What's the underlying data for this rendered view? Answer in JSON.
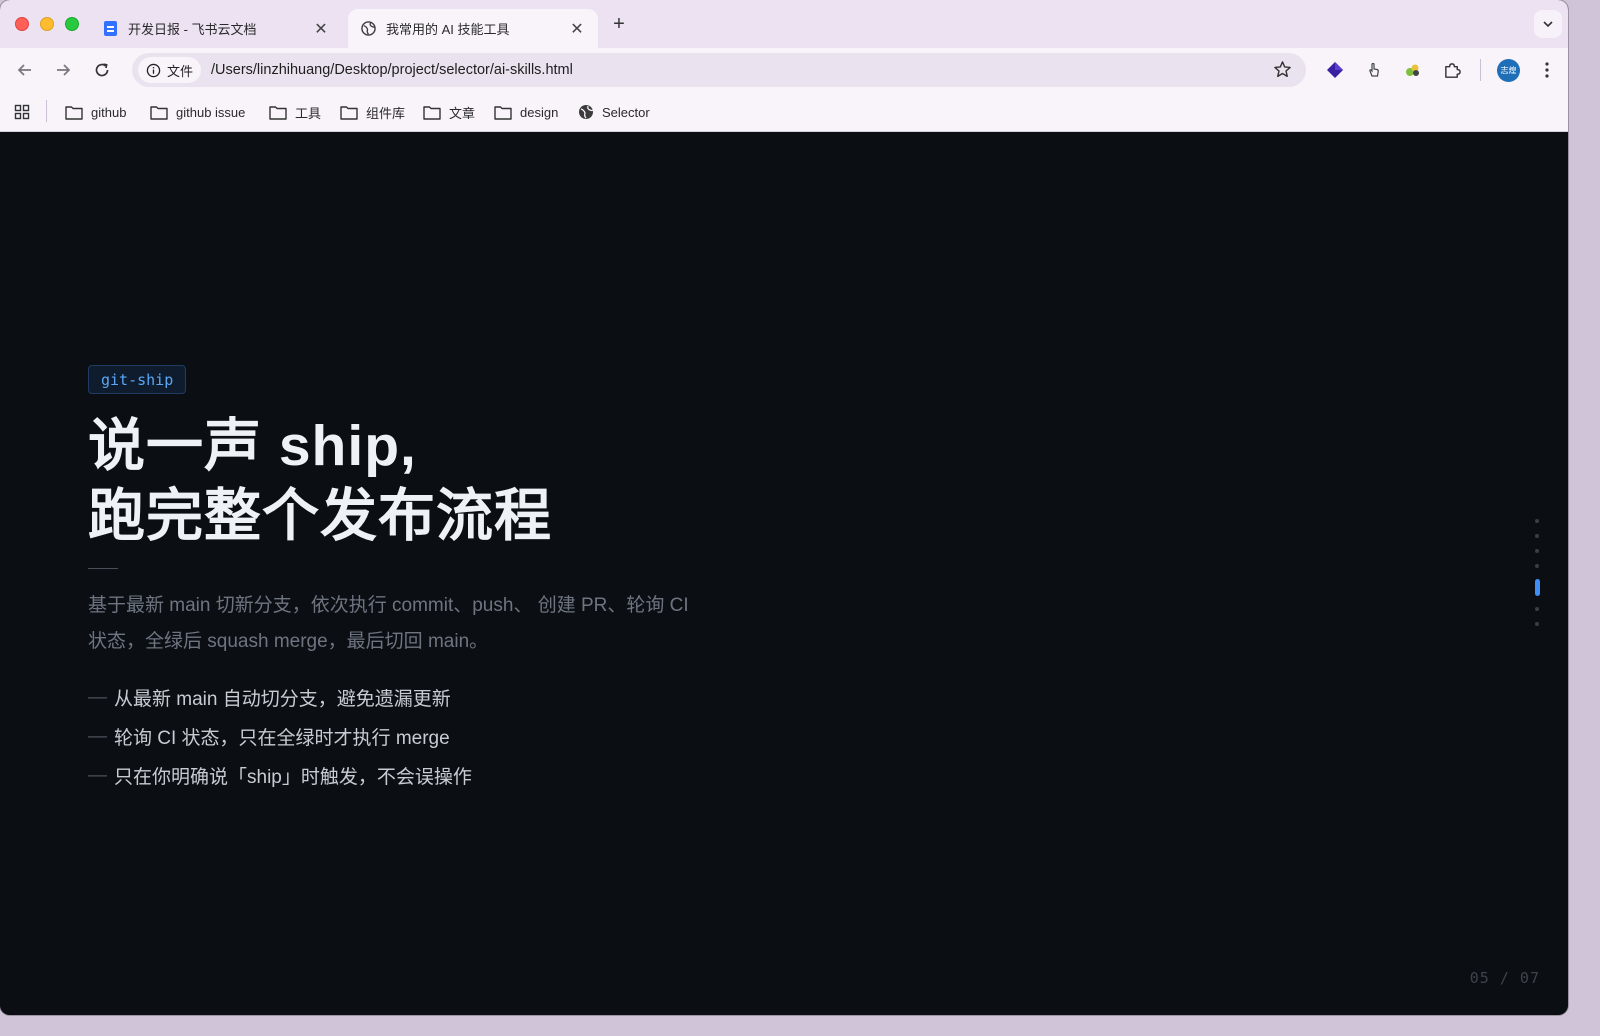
{
  "browser": {
    "tabs": [
      {
        "title": "开发日报 - 飞书云文档",
        "icon": "feishu-doc-icon"
      },
      {
        "title": "我常用的 AI 技能工具",
        "icon": "globe-icon",
        "active": true
      }
    ],
    "site_chip": "文件",
    "url": "/Users/linzhihuang/Desktop/project/selector/ai-skills.html",
    "avatar_text": "志煌",
    "bookmarks": [
      "github",
      "github issue",
      "工具",
      "组件库",
      "文章",
      "design",
      "Selector"
    ]
  },
  "slide": {
    "tag": "git-ship",
    "headline_line1": "说一声 ship,",
    "headline_line2": "跑完整个发布流程",
    "description": "基于最新 main 切新分支，依次执行 commit、push、 创建 PR、轮询 CI 状态，全绿后 squash merge，最后切回 main。",
    "bullets": [
      "从最新 main 自动切分支，避免遗漏更新",
      "轮询 CI 状态，只在全绿时才执行 merge",
      "只在你明确说「ship」时触发，不会误操作"
    ],
    "bullet_dash": "—",
    "pager": "05 / 07",
    "current_slide": 5,
    "total_slides": 7
  },
  "colors": {
    "page_bg": "#0b0f14",
    "accent": "#3f8ef5",
    "tag_text": "#5aa7f5",
    "headline": "#eef1f5",
    "description": "#6e7480"
  }
}
